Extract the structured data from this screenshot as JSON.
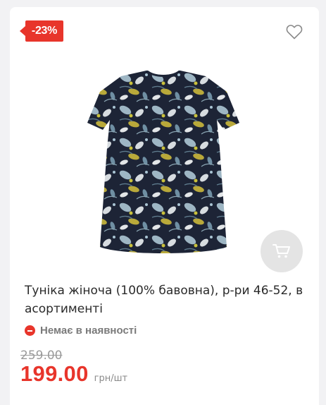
{
  "product": {
    "discount": "-23%",
    "title": "Туніка жіноча (100% бавовна), р-ри 46-52, в асортименті",
    "availability": "Немає в наявності",
    "old_price": "259.00",
    "price": "199.00",
    "unit": "грн/шт"
  },
  "icons": {
    "wishlist": "heart-outline-icon",
    "cart": "cart-icon",
    "stock": "minus-circle-icon"
  },
  "colors": {
    "accent": "#e8352b",
    "cart_button_bg": "#e4e4e4",
    "muted_text": "#9a9a9a"
  }
}
